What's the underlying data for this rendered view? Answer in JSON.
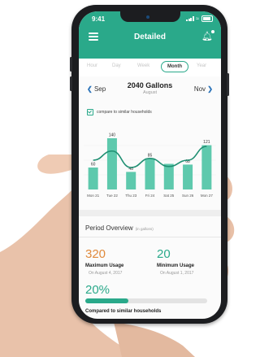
{
  "status": {
    "time": "9:41"
  },
  "header": {
    "title": "Detailed"
  },
  "tabs": [
    {
      "label": "Hour",
      "active": false
    },
    {
      "label": "Day",
      "active": false
    },
    {
      "label": "Week",
      "active": false
    },
    {
      "label": "Month",
      "active": true
    },
    {
      "label": "Year",
      "active": false
    }
  ],
  "period_nav": {
    "prev": "Sep",
    "next": "Nov",
    "total": "2040 Gallons",
    "subtitle": "August"
  },
  "compare": {
    "label": "compare to similar households",
    "checked": true
  },
  "chart_data": {
    "type": "bar",
    "categories": [
      "Mon 21",
      "Tue 22",
      "Thu 23",
      "Fri 24",
      "Sat 25",
      "Sun 26",
      "Mon 27"
    ],
    "values": [
      60,
      140,
      48,
      85,
      70,
      68,
      121
    ],
    "data_labels": [
      "60",
      "140",
      "48",
      "85",
      "",
      "68",
      "121"
    ],
    "overlay_line": [
      80,
      105,
      60,
      85,
      63,
      80,
      118
    ],
    "ylim": [
      0,
      160
    ]
  },
  "period_overview": {
    "title": "Period Overview",
    "unit_note": "(in gallons)",
    "max": {
      "value": "320",
      "label": "Maximum Usage",
      "date": "On August 4, 2017"
    },
    "min": {
      "value": "20",
      "label": "Minimum Usage",
      "date": "On August 1, 2017"
    },
    "compare_pct": "20%",
    "compare_fraction": 0.35,
    "compare_label": "Compared to similar households"
  },
  "colors": {
    "accent": "#2aa98a",
    "bars": "#5ec9ad",
    "max": "#e08a3c",
    "nav_chevron": "#2a72b8"
  }
}
